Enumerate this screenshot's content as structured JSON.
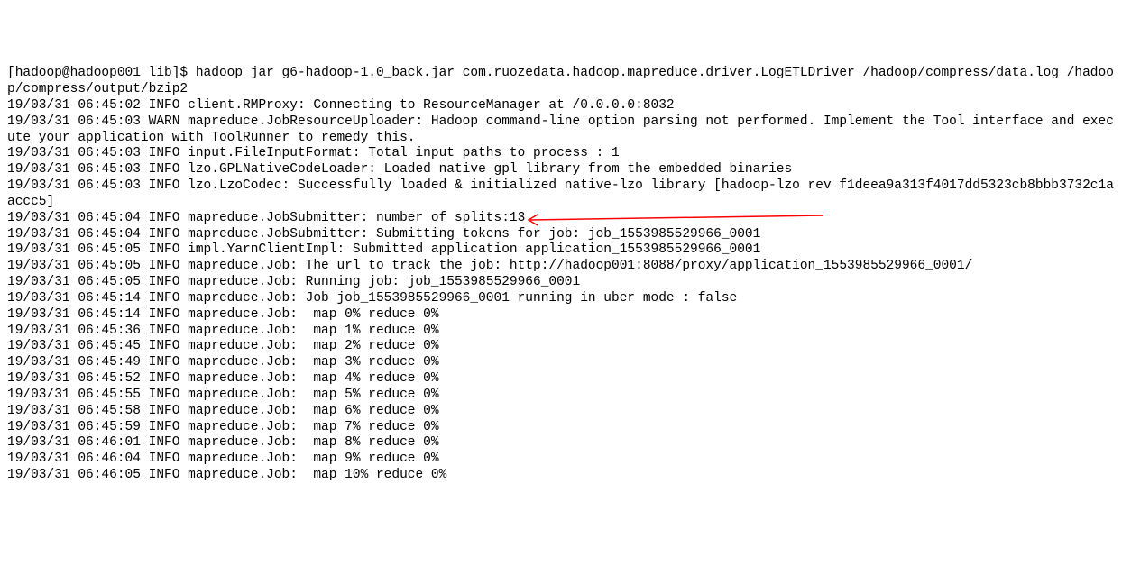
{
  "prompt": "[hadoop@hadoop001 lib]$ ",
  "command": "hadoop jar g6-hadoop-1.0_back.jar com.ruozedata.hadoop.mapreduce.driver.LogETLDriver /hadoop/compress/data.log /hadoop/compress/output/bzip2",
  "lines": [
    "19/03/31 06:45:02 INFO client.RMProxy: Connecting to ResourceManager at /0.0.0.0:8032",
    "19/03/31 06:45:03 WARN mapreduce.JobResourceUploader: Hadoop command-line option parsing not performed. Implement the Tool interface and execute your application with ToolRunner to remedy this.",
    "19/03/31 06:45:03 INFO input.FileInputFormat: Total input paths to process : 1",
    "19/03/31 06:45:03 INFO lzo.GPLNativeCodeLoader: Loaded native gpl library from the embedded binaries",
    "19/03/31 06:45:03 INFO lzo.LzoCodec: Successfully loaded & initialized native-lzo library [hadoop-lzo rev f1deea9a313f4017dd5323cb8bbb3732c1aaccc5]",
    "19/03/31 06:45:04 INFO mapreduce.JobSubmitter: number of splits:13",
    "19/03/31 06:45:04 INFO mapreduce.JobSubmitter: Submitting tokens for job: job_1553985529966_0001",
    "19/03/31 06:45:05 INFO impl.YarnClientImpl: Submitted application application_1553985529966_0001",
    "19/03/31 06:45:05 INFO mapreduce.Job: The url to track the job: http://hadoop001:8088/proxy/application_1553985529966_0001/",
    "19/03/31 06:45:05 INFO mapreduce.Job: Running job: job_1553985529966_0001",
    "19/03/31 06:45:14 INFO mapreduce.Job: Job job_1553985529966_0001 running in uber mode : false",
    "19/03/31 06:45:14 INFO mapreduce.Job:  map 0% reduce 0%",
    "19/03/31 06:45:36 INFO mapreduce.Job:  map 1% reduce 0%",
    "19/03/31 06:45:45 INFO mapreduce.Job:  map 2% reduce 0%",
    "19/03/31 06:45:49 INFO mapreduce.Job:  map 3% reduce 0%",
    "19/03/31 06:45:52 INFO mapreduce.Job:  map 4% reduce 0%",
    "19/03/31 06:45:55 INFO mapreduce.Job:  map 5% reduce 0%",
    "19/03/31 06:45:58 INFO mapreduce.Job:  map 6% reduce 0%",
    "19/03/31 06:45:59 INFO mapreduce.Job:  map 7% reduce 0%",
    "19/03/31 06:46:01 INFO mapreduce.Job:  map 8% reduce 0%",
    "19/03/31 06:46:04 INFO mapreduce.Job:  map 9% reduce 0%",
    "19/03/31 06:46:05 INFO mapreduce.Job:  map 10% reduce 0%"
  ],
  "highlight_index": 5,
  "arrow_color": "#ff0000"
}
